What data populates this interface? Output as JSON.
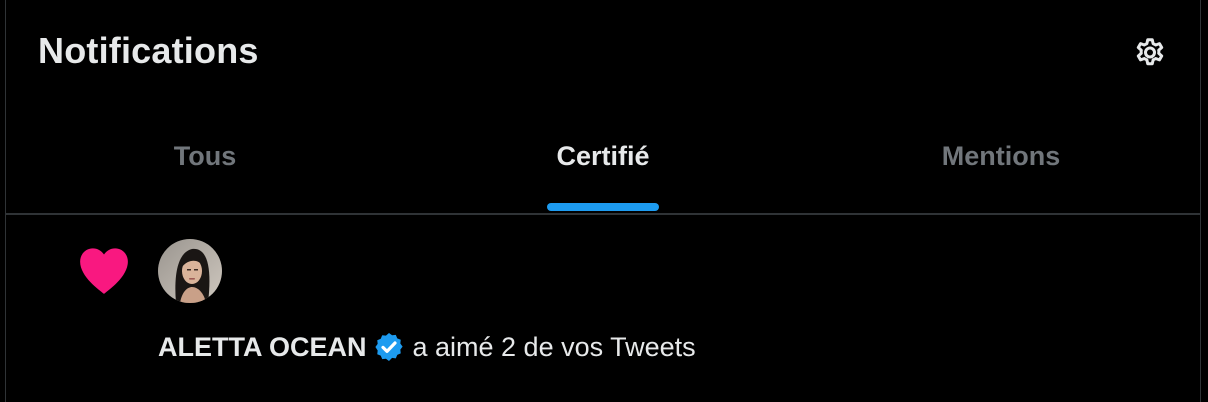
{
  "header": {
    "title": "Notifications",
    "settings_icon": "gear-icon"
  },
  "tabs": [
    {
      "label": "Tous",
      "active": false
    },
    {
      "label": "Certifié",
      "active": true
    },
    {
      "label": "Mentions",
      "active": false
    }
  ],
  "colors": {
    "background": "#000000",
    "text_primary": "#e7e9ea",
    "text_secondary": "#71767b",
    "accent": "#1d9bf0",
    "like": "#f91880",
    "divider": "#2f3336"
  },
  "notification": {
    "type_icon": "heart-icon",
    "user_name": "ALETTA OCEAN",
    "verified": true,
    "verified_icon": "verified-badge-icon",
    "action_text": "a aimé 2 de vos Tweets"
  }
}
